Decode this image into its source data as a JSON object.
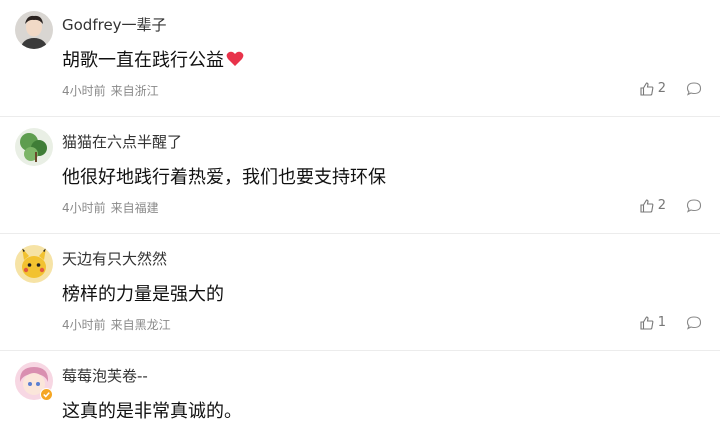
{
  "comments": [
    {
      "username": "Godfrey一辈子",
      "content": "胡歌一直在践行公益",
      "has_heart_emoji": true,
      "time": "4小时前",
      "location": "来自浙江",
      "likes": "2",
      "avatar": "person-portrait"
    },
    {
      "username": "猫猫在六点半醒了",
      "content": "他很好地践行着热爱，我们也要支持环保",
      "has_heart_emoji": false,
      "time": "4小时前",
      "location": "来自福建",
      "likes": "2",
      "avatar": "green-nature"
    },
    {
      "username": "天边有只大然然",
      "content": "榜样的力量是强大的",
      "has_heart_emoji": false,
      "time": "4小时前",
      "location": "来自黑龙江",
      "likes": "1",
      "avatar": "yellow-cartoon"
    },
    {
      "username": "莓莓泡芙卷--",
      "content": "这真的是非常真诚的。",
      "has_heart_emoji": false,
      "time": "",
      "location": "",
      "likes": "",
      "avatar": "anime-girl-verified"
    }
  ],
  "colors": {
    "heart": "#e8334a",
    "verified_badge": "#f5a623"
  }
}
